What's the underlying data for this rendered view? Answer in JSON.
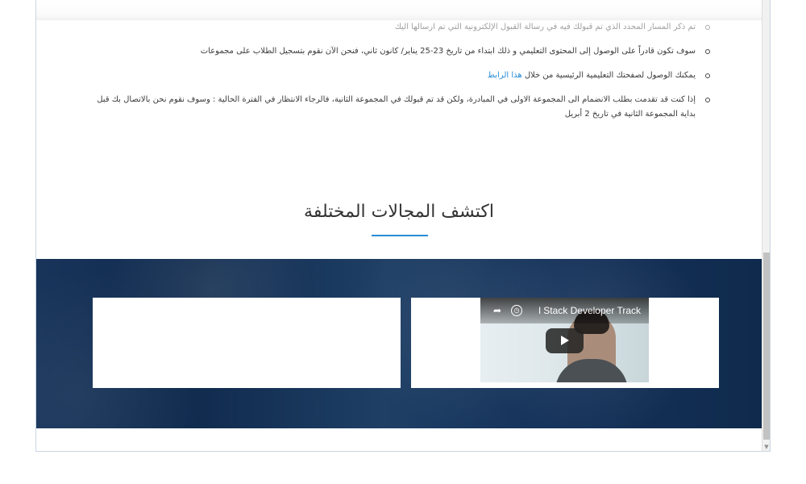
{
  "content": {
    "bullets": [
      {
        "text": "تم ذكر المسار المحدد الذي تم قبولك فيه في رسالة القبول الإلكترونية التي تم ارسالها اليك",
        "faded": true
      },
      {
        "text": "سوف تكون قادراً على الوصول إلى المحتوى التعليمي و ذلك ابتداء من تاريخ 23-25 يناير/ كانون ثاني، فنحن الآن نقوم بتسجيل الطلاب على مجموعات",
        "faded": false
      },
      {
        "text_before_link": "يمكنك الوصول لصفحتك التعليمية الرئيسية من خلال ",
        "link": "هذا الرابط",
        "faded": false
      },
      {
        "text": "إذا كنت قد تقدمت بطلب الانضمام الى المجموعة الاولى في المبادرة، ولكن قد تم قبولك في المجموعة الثانية، فالرجاء الانتظار في الفترة الحالية : وسوف نقوم نحن بالاتصال بك قبل بداية المجموعة الثانية في تاريخ 2 أبريل",
        "faded": false
      }
    ],
    "section_title": "اكتشف المجالات المختلفة"
  },
  "video": {
    "title": "l Stack Developer Track",
    "icons": {
      "share": "share-icon",
      "clock": "clock-icon",
      "play": "play-button"
    }
  },
  "colors": {
    "accent": "#2a8cd6",
    "band": "#17365e",
    "text": "#3b3b3b"
  },
  "icons": {
    "bullet": "circle-bullet-icon",
    "scroll_down": "scroll-down-arrow-icon"
  }
}
